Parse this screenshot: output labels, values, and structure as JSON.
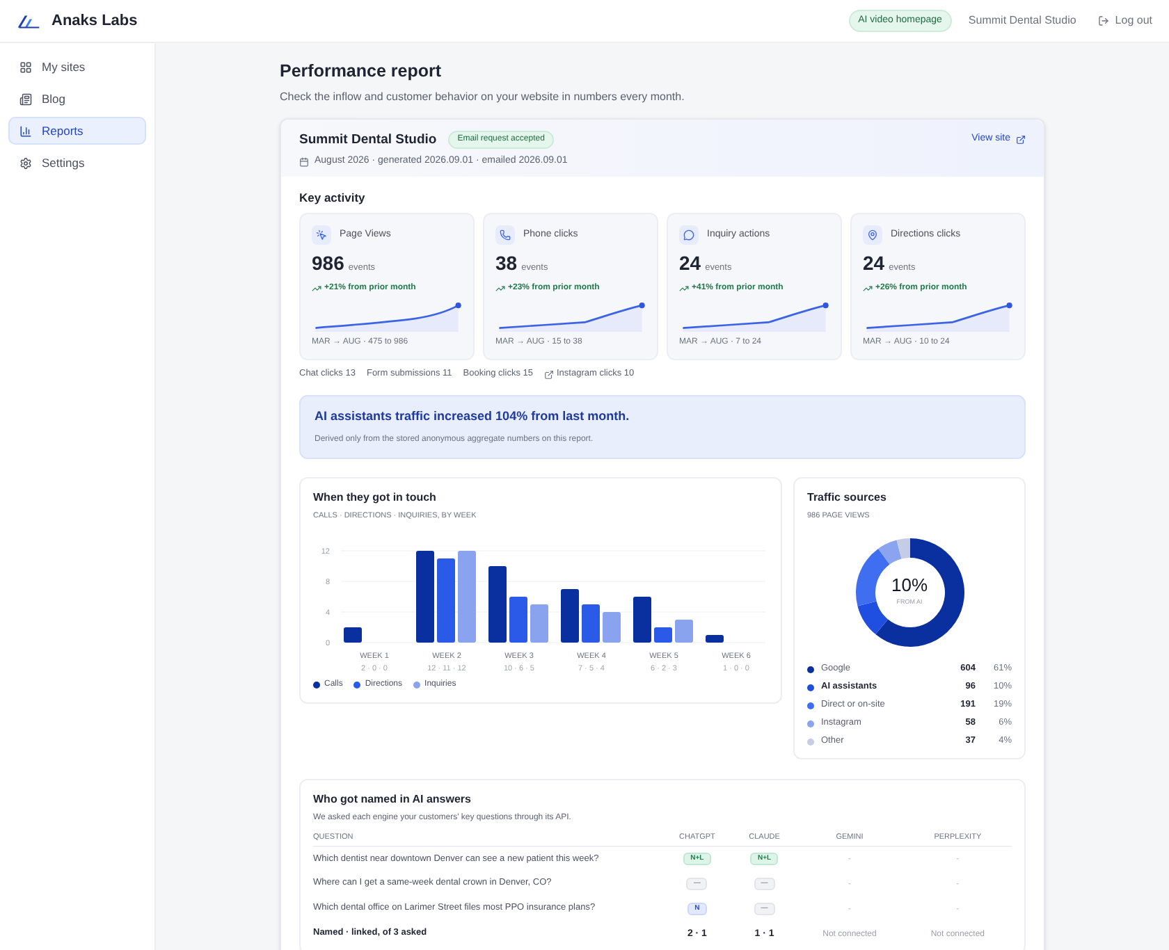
{
  "app": {
    "brand": "Anaks Labs",
    "badge": "AI video homepage",
    "site": "Summit Dental Studio",
    "logout": "Log out"
  },
  "sidebar": {
    "items": [
      {
        "label": "My sites",
        "selected": false
      },
      {
        "label": "Blog",
        "selected": false
      },
      {
        "label": "Reports",
        "selected": true
      },
      {
        "label": "Settings",
        "selected": false
      }
    ]
  },
  "page": {
    "title": "Performance report",
    "subtitle": "Check the inflow and customer behavior on your website in numbers every month."
  },
  "report": {
    "site": "Summit Dental Studio",
    "status": "Email request accepted",
    "dates": "August 2026 · generated 2026.09.01 · emailed 2026.09.01",
    "view_site": "View site"
  },
  "key_activity": {
    "title": "Key activity",
    "metrics": [
      {
        "label": "Page Views",
        "value": "986",
        "unit": "events",
        "change": "+21% from prior month",
        "range": "MAR → AUG · 475 to 986"
      },
      {
        "label": "Phone clicks",
        "value": "38",
        "unit": "events",
        "change": "+23% from prior month",
        "range": "MAR → AUG · 15 to 38"
      },
      {
        "label": "Inquiry actions",
        "value": "24",
        "unit": "events",
        "change": "+41% from prior month",
        "range": "MAR → AUG · 7 to 24"
      },
      {
        "label": "Directions clicks",
        "value": "24",
        "unit": "events",
        "change": "+26% from prior month",
        "range": "MAR → AUG · 10 to 24"
      }
    ],
    "extras": [
      {
        "text": "Chat clicks 13",
        "external": false
      },
      {
        "text": "Form submissions 11",
        "external": false
      },
      {
        "text": "Booking clicks 15",
        "external": false
      },
      {
        "text": "Instagram clicks 10",
        "external": true
      }
    ]
  },
  "insight": {
    "headline": "AI assistants traffic increased 104% from last month.",
    "note": "Derived only from the stored anonymous aggregate numbers on this report."
  },
  "contact_chart": {
    "title": "When they got in touch",
    "subtitle": "CALLS · DIRECTIONS · INQUIRIES, BY WEEK",
    "week_breakdowns": [
      "2 · 0 · 0",
      "12 · 11 · 12",
      "10 · 6 · 5",
      "7 · 5 · 4",
      "6 · 2 · 3",
      "1 · 0 · 0"
    ],
    "chart_data": {
      "type": "bar",
      "categories": [
        "WEEK 1",
        "WEEK 2",
        "WEEK 3",
        "WEEK 4",
        "WEEK 5",
        "WEEK 6"
      ],
      "ylim": [
        0,
        12
      ],
      "yticks": [
        0,
        4,
        8,
        12
      ],
      "series": [
        {
          "name": "Calls",
          "color": "#0a2f9e",
          "values": [
            2,
            12,
            10,
            7,
            6,
            1
          ]
        },
        {
          "name": "Directions",
          "color": "#2b5ae8",
          "values": [
            0,
            11,
            6,
            5,
            2,
            0
          ]
        },
        {
          "name": "Inquiries",
          "color": "#8aa3ef",
          "values": [
            0,
            12,
            5,
            4,
            3,
            0
          ]
        }
      ]
    }
  },
  "traffic": {
    "title": "Traffic sources",
    "subtitle": "986 PAGE VIEWS",
    "center_value": "10%",
    "center_label": "FROM AI",
    "legend": [
      {
        "count": "604",
        "share": "61%",
        "color": "#0a2f9e",
        "highlighted": false
      },
      {
        "count": "96",
        "share": "10%",
        "color": "#1f4fe0",
        "highlighted": true
      },
      {
        "count": "191",
        "share": "19%",
        "color": "#3f6ff0",
        "highlighted": false
      },
      {
        "count": "58",
        "share": "6%",
        "color": "#8ba4ef",
        "highlighted": false
      },
      {
        "count": "37",
        "share": "4%",
        "color": "#c5cde6",
        "highlighted": false
      }
    ],
    "chart_data": {
      "type": "donut",
      "categories": [
        "Google",
        "AI assistants",
        "Direct or on-site",
        "Instagram",
        "Other"
      ],
      "values": [
        61,
        10,
        19,
        6,
        4
      ]
    }
  },
  "ai_answers": {
    "title": "Who got named in AI answers",
    "subtitle": "We asked each engine your customers' key questions through its API.",
    "columns": [
      "QUESTION",
      "CHATGPT",
      "CLAUDE",
      "GEMINI",
      "PERPLEXITY"
    ],
    "rows": [
      {
        "cells": [
          {
            "text": "Which dentist near downtown Denver can see a new patient this week?",
            "kind": "question"
          },
          {
            "text": "N+L",
            "kind": "linked"
          },
          {
            "text": "N+L",
            "kind": "linked"
          },
          {
            "text": "-",
            "kind": "none"
          },
          {
            "text": "-",
            "kind": "none"
          }
        ]
      },
      {
        "cells": [
          {
            "text": "Where can I get a same-week dental crown in Denver, CO?",
            "kind": "question"
          },
          {
            "text": "—",
            "kind": "missed"
          },
          {
            "text": "—",
            "kind": "missed"
          },
          {
            "text": "-",
            "kind": "none"
          },
          {
            "text": "-",
            "kind": "none"
          }
        ]
      },
      {
        "cells": [
          {
            "text": "Which dental office on Larimer Street files most PPO insurance plans?",
            "kind": "question"
          },
          {
            "text": "N",
            "kind": "named"
          },
          {
            "text": "—",
            "kind": "missed"
          },
          {
            "text": "-",
            "kind": "none"
          },
          {
            "text": "-",
            "kind": "none"
          }
        ]
      },
      {
        "cells": [
          {
            "text": "Named · linked, of 3 asked",
            "kind": "label"
          },
          {
            "text": "2 · 1",
            "kind": "score"
          },
          {
            "text": "1 · 1",
            "kind": "score"
          },
          {
            "text": "Not connected",
            "kind": "off"
          },
          {
            "text": "Not connected",
            "kind": "off"
          }
        ]
      }
    ]
  }
}
